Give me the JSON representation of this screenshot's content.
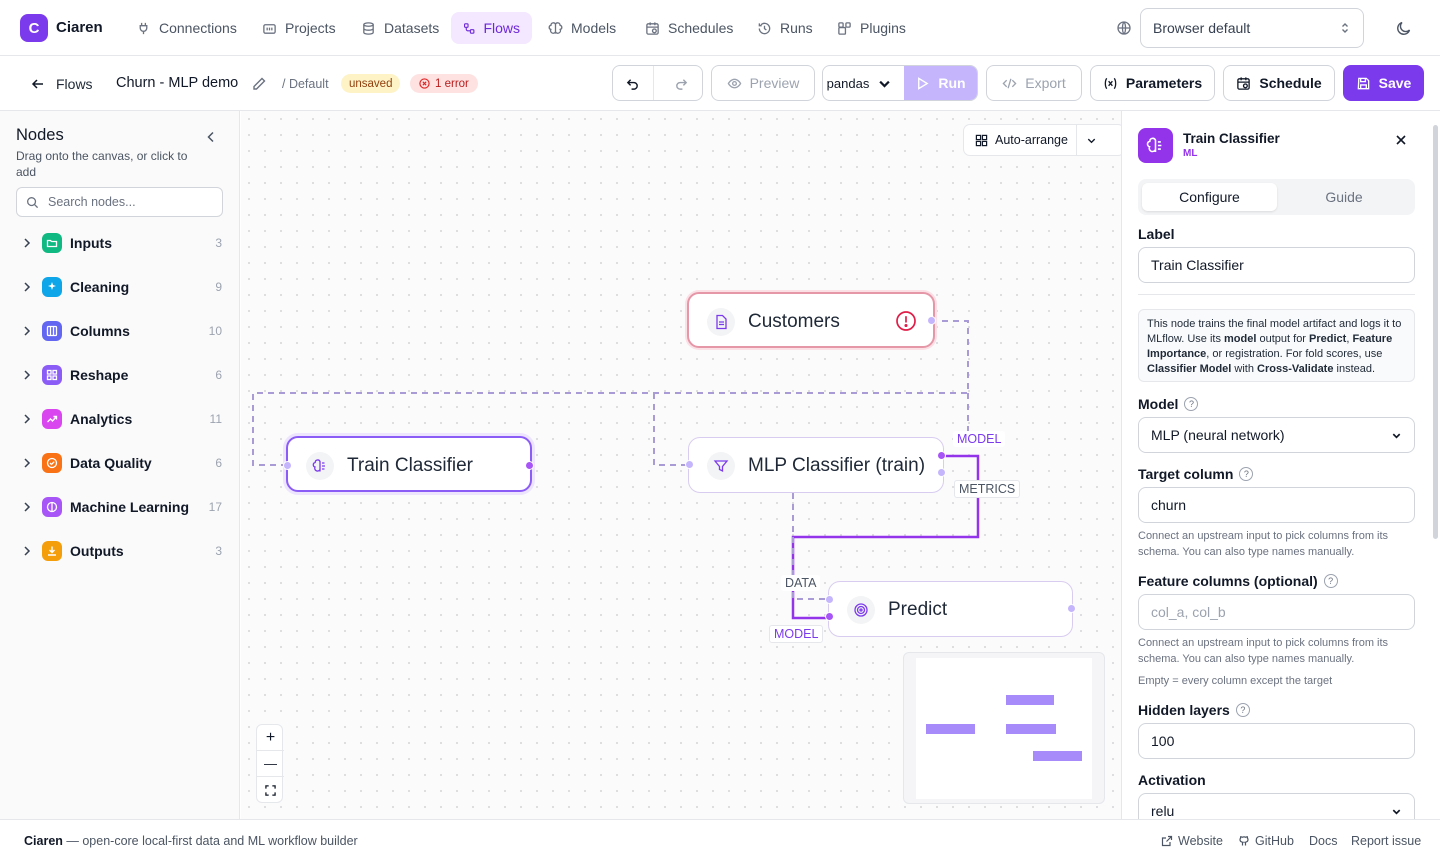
{
  "app": {
    "logo_letter": "C",
    "brand": "Ciaren"
  },
  "nav": {
    "items": [
      {
        "label": "Connections"
      },
      {
        "label": "Projects"
      },
      {
        "label": "Datasets"
      },
      {
        "label": "Flows"
      },
      {
        "label": "Models"
      },
      {
        "label": "Schedules"
      },
      {
        "label": "Runs"
      },
      {
        "label": "Plugins"
      }
    ],
    "active": "Flows",
    "language": "Browser default"
  },
  "toolbar": {
    "back_label": "Flows",
    "flow_name": "Churn - MLP demo",
    "project": "/ Default",
    "unsaved_badge": "unsaved",
    "error_badge": "1 error",
    "preview_label": "Preview",
    "engine": "pandas",
    "run_label": "Run",
    "export_label": "Export",
    "parameters_label": "Parameters",
    "schedule_label": "Schedule",
    "save_label": "Save"
  },
  "sidebar": {
    "title": "Nodes",
    "subtitle": "Drag onto the canvas, or click to add",
    "search_placeholder": "Search nodes...",
    "categories": [
      {
        "label": "Inputs",
        "count": "3",
        "color": "#10b981"
      },
      {
        "label": "Cleaning",
        "count": "9",
        "color": "#0ea5e9"
      },
      {
        "label": "Columns",
        "count": "10",
        "color": "#6366f1"
      },
      {
        "label": "Reshape",
        "count": "6",
        "color": "#8b5cf6"
      },
      {
        "label": "Analytics",
        "count": "11",
        "color": "#d946ef"
      },
      {
        "label": "Data Quality",
        "count": "6",
        "color": "#f97316"
      },
      {
        "label": "Machine Learning",
        "count": "17",
        "color": "#a855f7"
      },
      {
        "label": "Outputs",
        "count": "3",
        "color": "#f59e0b"
      }
    ]
  },
  "canvas": {
    "auto_arrange": "Auto-arrange",
    "nodes": {
      "customers": "Customers",
      "train_classifier": "Train Classifier",
      "mlp_classifier": "MLP Classifier (train)",
      "predict": "Predict"
    },
    "edge_labels": {
      "model_top": "MODEL",
      "metrics": "METRICS",
      "data": "DATA",
      "model_bottom": "MODEL"
    },
    "zoom": {
      "in": "+",
      "out": "—"
    }
  },
  "panel": {
    "node_title": "Train Classifier",
    "node_category": "ML",
    "tabs": [
      {
        "label": "Configure"
      },
      {
        "label": "Guide"
      }
    ],
    "active_tab": "Configure",
    "label_field": {
      "label": "Label",
      "value": "Train Classifier"
    },
    "info": {
      "t1": "This node trains the final model artifact and logs it to MLflow. Use its ",
      "b1": "model",
      "t2": " output for ",
      "b2": "Predict",
      "t3": ", ",
      "b3": "Feature Importance",
      "t4": ", or registration. For fold scores, use ",
      "b4": "Classifier Model",
      "t5": " with ",
      "b5": "Cross-Validate",
      "t6": " instead."
    },
    "model": {
      "label": "Model",
      "value": "MLP (neural network)"
    },
    "target": {
      "label": "Target column",
      "value": "churn",
      "hint": "Connect an upstream input to pick columns from its schema. You can also type names manually."
    },
    "features": {
      "label": "Feature columns (optional)",
      "placeholder": "col_a, col_b",
      "hint": "Connect an upstream input to pick columns from its schema. You can also type names manually.",
      "hint2": "Empty = every column except the target"
    },
    "hidden_layers": {
      "label": "Hidden layers",
      "value": "100"
    },
    "activation": {
      "label": "Activation",
      "value": "relu"
    }
  },
  "footer": {
    "brand": "Ciaren",
    "tagline": " — open-core local-first data and ML workflow builder",
    "links": [
      {
        "label": "Website"
      },
      {
        "label": "GitHub"
      },
      {
        "label": "Docs"
      },
      {
        "label": "Report issue"
      }
    ]
  },
  "colors": {
    "accent": "#7c3aed",
    "error": "#e11d48",
    "warning_bg": "#fef3c7"
  }
}
